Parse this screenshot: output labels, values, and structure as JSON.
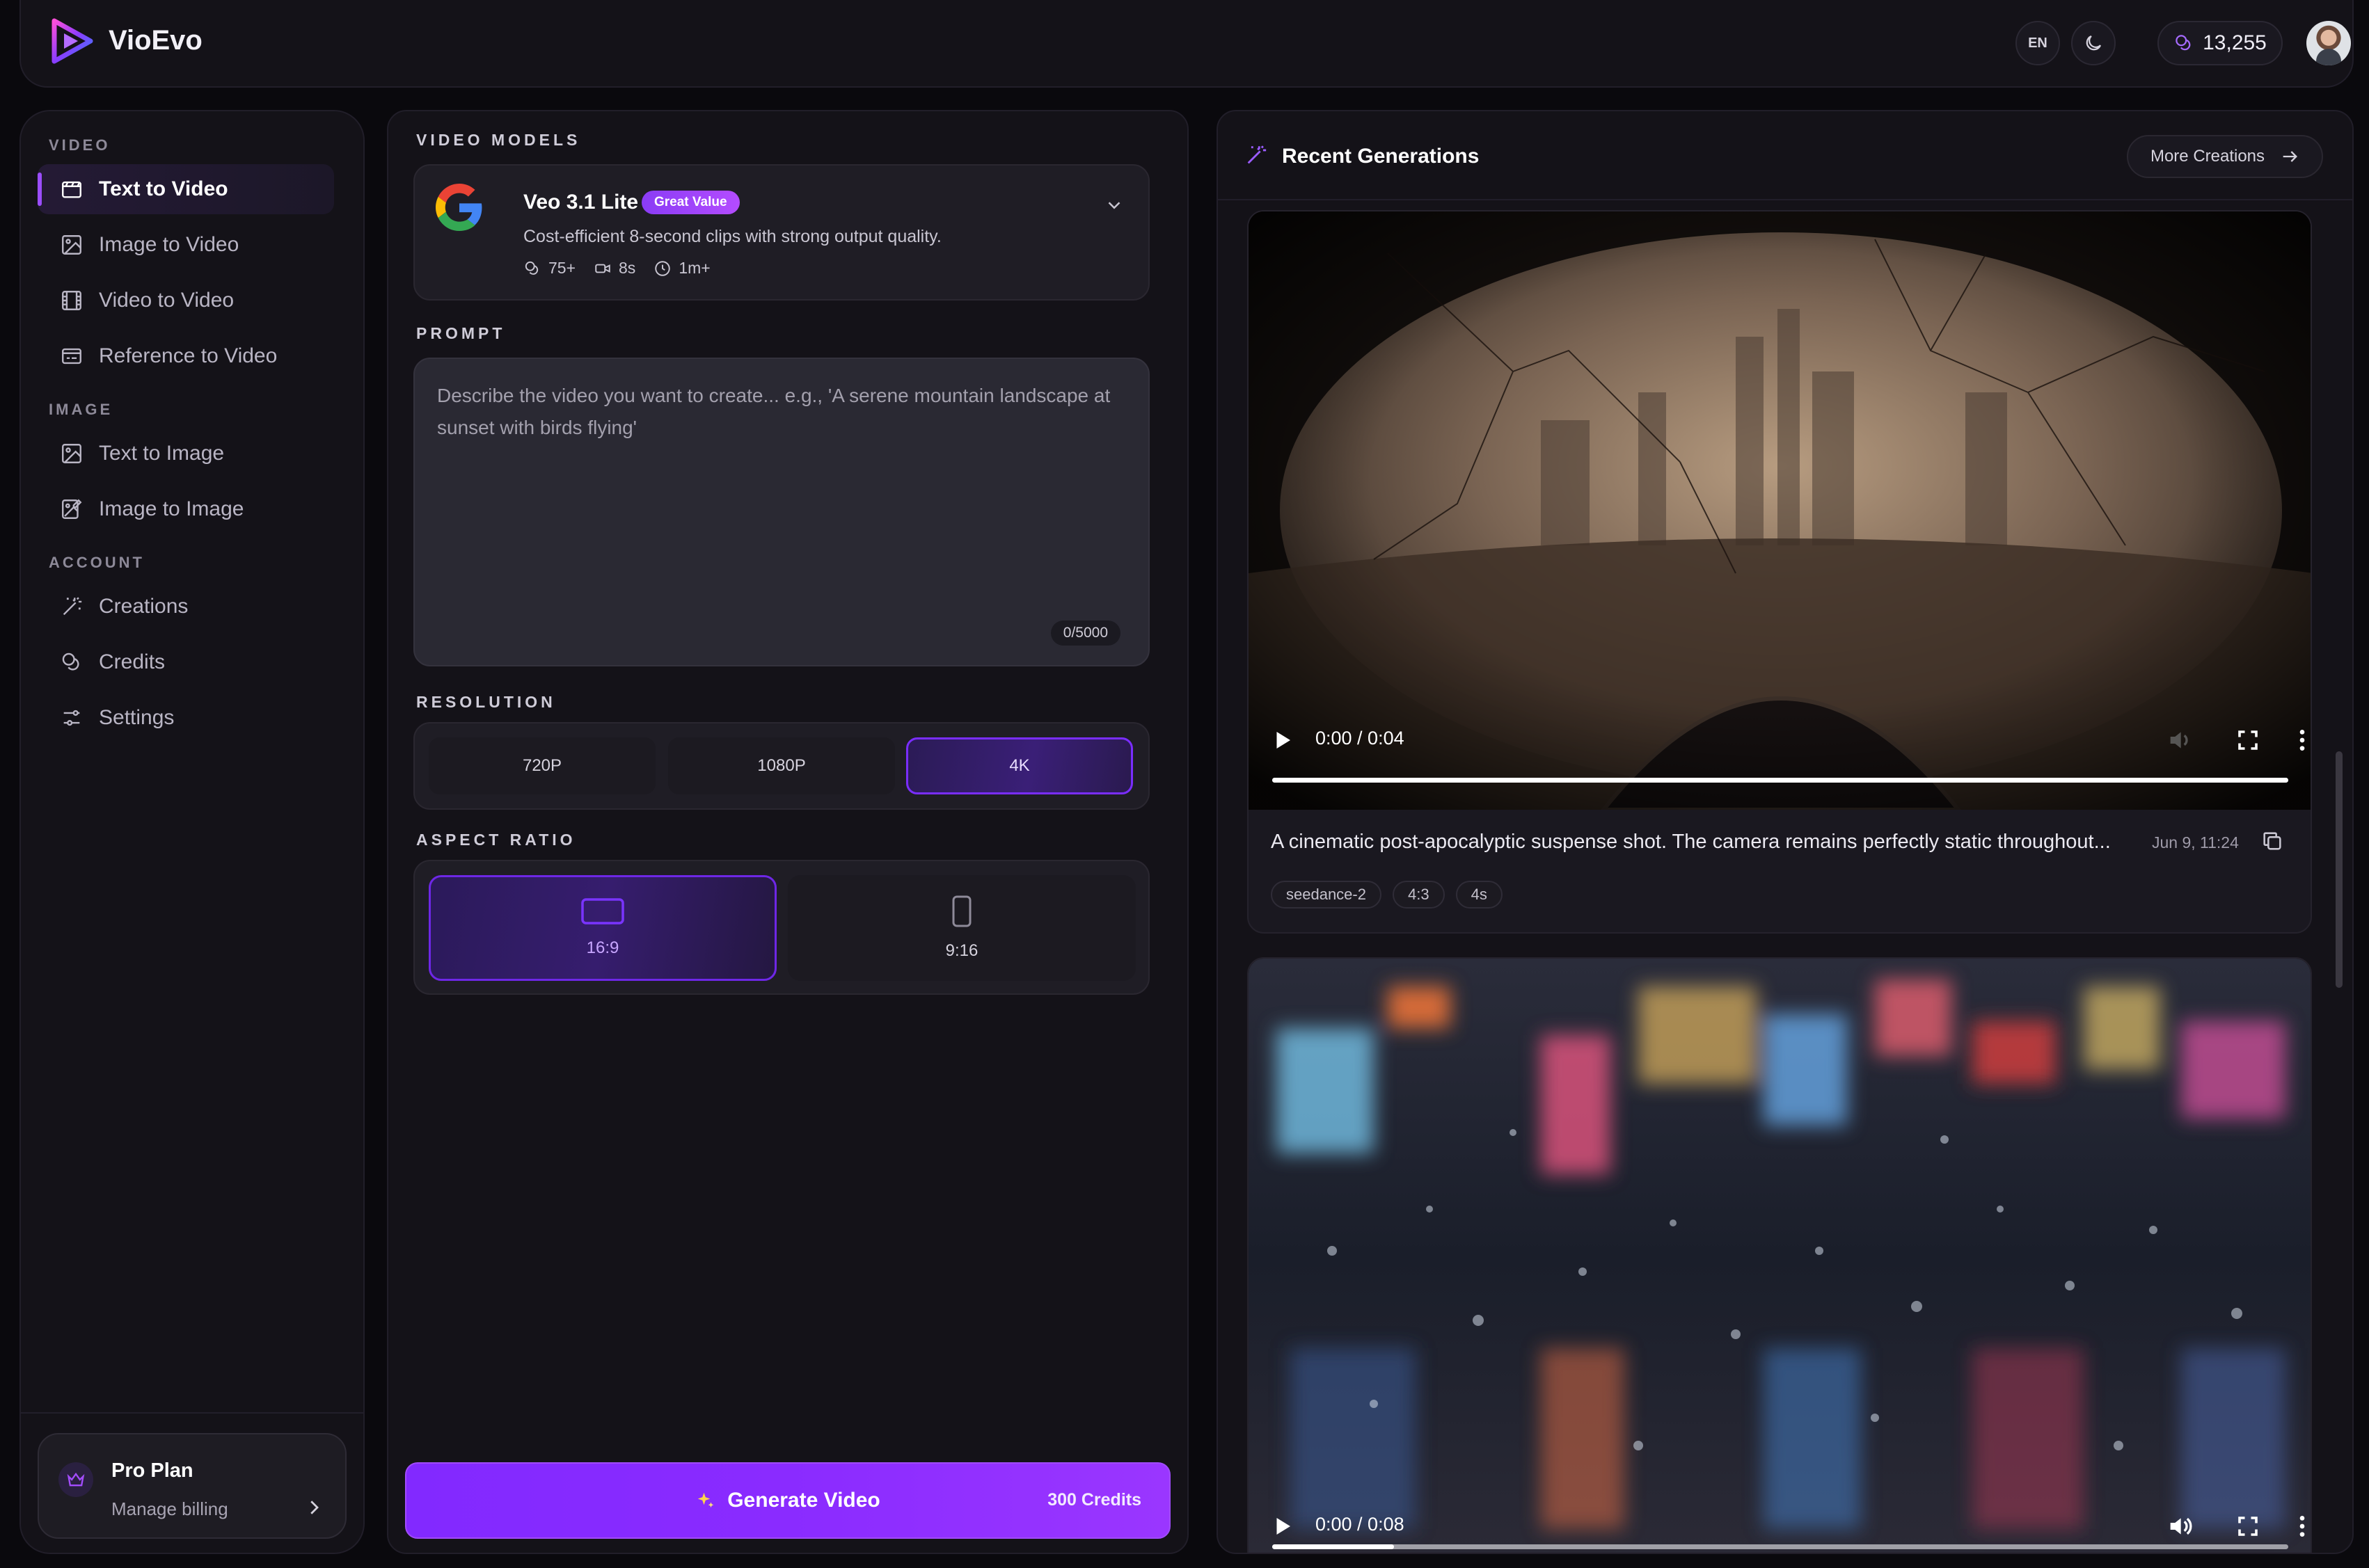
{
  "header": {
    "brand": "VioEvo",
    "language": "EN",
    "credits_balance": "13,255",
    "accent": "#8a2bff"
  },
  "sidebar": {
    "sections": [
      {
        "label": "VIDEO"
      },
      {
        "label": "IMAGE"
      },
      {
        "label": "ACCOUNT"
      }
    ],
    "items": [
      {
        "label": "Text to Video",
        "icon": "text-video-icon",
        "active": true
      },
      {
        "label": "Image to Video",
        "icon": "image-video-icon"
      },
      {
        "label": "Video to Video",
        "icon": "film-icon"
      },
      {
        "label": "Reference to Video",
        "icon": "reference-icon"
      },
      {
        "label": "Text to Image",
        "icon": "image-icon"
      },
      {
        "label": "Image to Image",
        "icon": "image-edit-icon"
      },
      {
        "label": "Creations",
        "icon": "wand-icon"
      },
      {
        "label": "Credits",
        "icon": "coins-icon"
      },
      {
        "label": "Settings",
        "icon": "sliders-icon"
      }
    ],
    "plan": {
      "title": "Pro Plan",
      "subtitle": "Manage billing"
    }
  },
  "center": {
    "models_label": "VIDEO MODELS",
    "model": {
      "name": "Veo 3.1 Lite",
      "badge": "Great Value",
      "description": "Cost-efficient 8-second clips with strong output quality.",
      "meta": [
        "75+",
        "8s",
        "1m+"
      ]
    },
    "prompt_label": "PROMPT",
    "prompt_placeholder": "Describe the video you want to create... e.g., 'A serene mountain landscape at sunset with birds flying'",
    "prompt_value": "",
    "prompt_counter": "0/5000",
    "resolution_label": "RESOLUTION",
    "resolutions": [
      "720P",
      "1080P",
      "4K"
    ],
    "resolution_selected": "4K",
    "aspect_label": "ASPECT RATIO",
    "aspects": [
      "16:9",
      "9:16"
    ],
    "aspect_selected": "16:9",
    "generate_label": "Generate Video",
    "generate_cost": "300 Credits"
  },
  "recent": {
    "title": "Recent Generations",
    "more_label": "More Creations",
    "items": [
      {
        "time": "0:00 / 0:04",
        "progress": 1.0,
        "caption": "A cinematic post-apocalyptic suspense shot. The camera remains perfectly static throughout...",
        "date": "Jun 9, 11:24",
        "tags": [
          "seedance-2",
          "4:3",
          "4s"
        ]
      },
      {
        "time": "0:00 / 0:08",
        "progress": 0.12
      }
    ]
  }
}
